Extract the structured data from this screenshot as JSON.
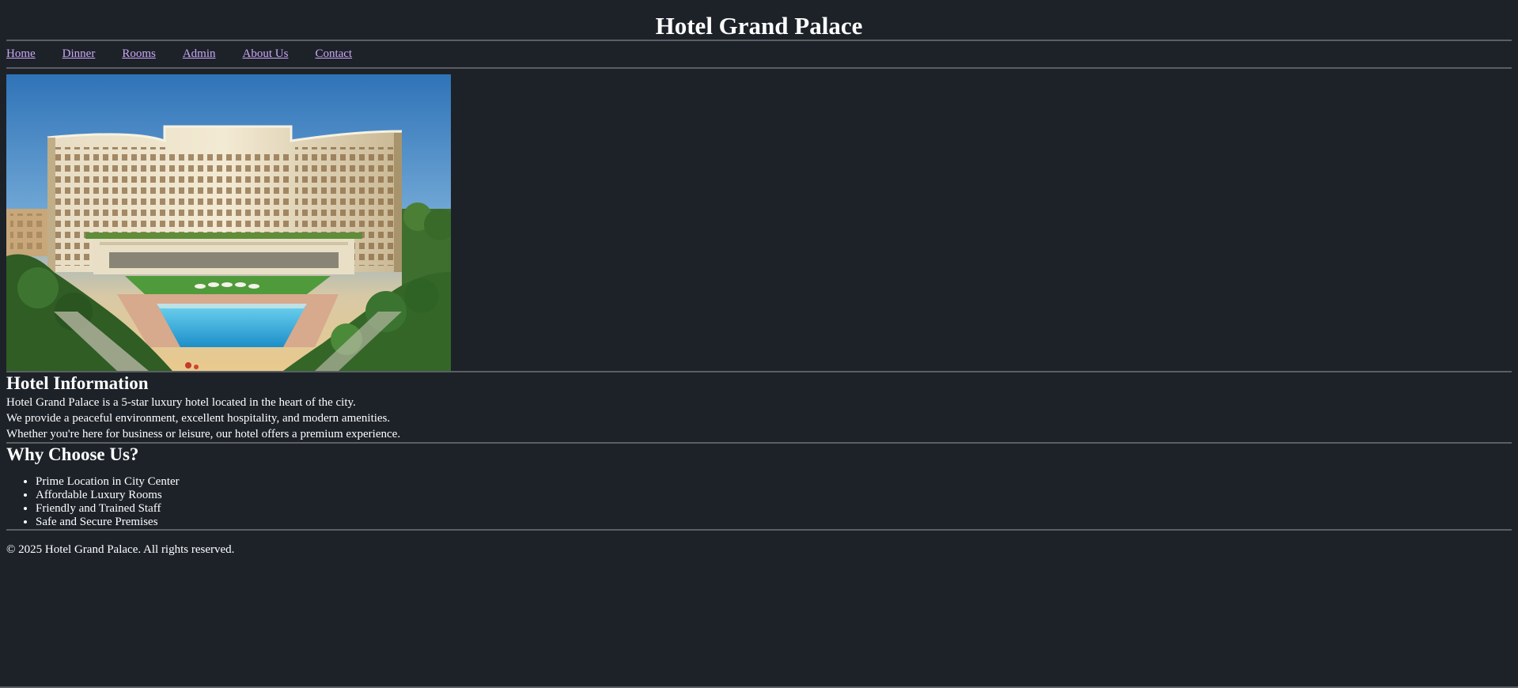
{
  "header": {
    "title": "Hotel Grand Palace"
  },
  "nav": {
    "items": [
      {
        "label": "Home"
      },
      {
        "label": "Dinner"
      },
      {
        "label": "Rooms"
      },
      {
        "label": "Admin"
      },
      {
        "label": "About Us"
      },
      {
        "label": "Contact"
      }
    ],
    "link_color": "#c9a7f4"
  },
  "hero": {
    "icon": "hotel-photo-image"
  },
  "info": {
    "heading": "Hotel Information",
    "paragraphs": [
      "Hotel Grand Palace is a 5-star luxury hotel located in the heart of the city.",
      "We provide a peaceful environment, excellent hospitality, and modern amenities.",
      "Whether you're here for business or leisure, our hotel offers a premium experience."
    ]
  },
  "why": {
    "heading": "Why Choose Us?",
    "items": [
      "Prime Location in City Center",
      "Affordable Luxury Rooms",
      "Friendly and Trained Staff",
      "Safe and Secure Premises"
    ]
  },
  "footer": {
    "text": "© 2025 Hotel Grand Palace. All rights reserved."
  },
  "colors": {
    "background": "#1d2229",
    "text": "#ffffff",
    "rule": "#5b5f64"
  }
}
